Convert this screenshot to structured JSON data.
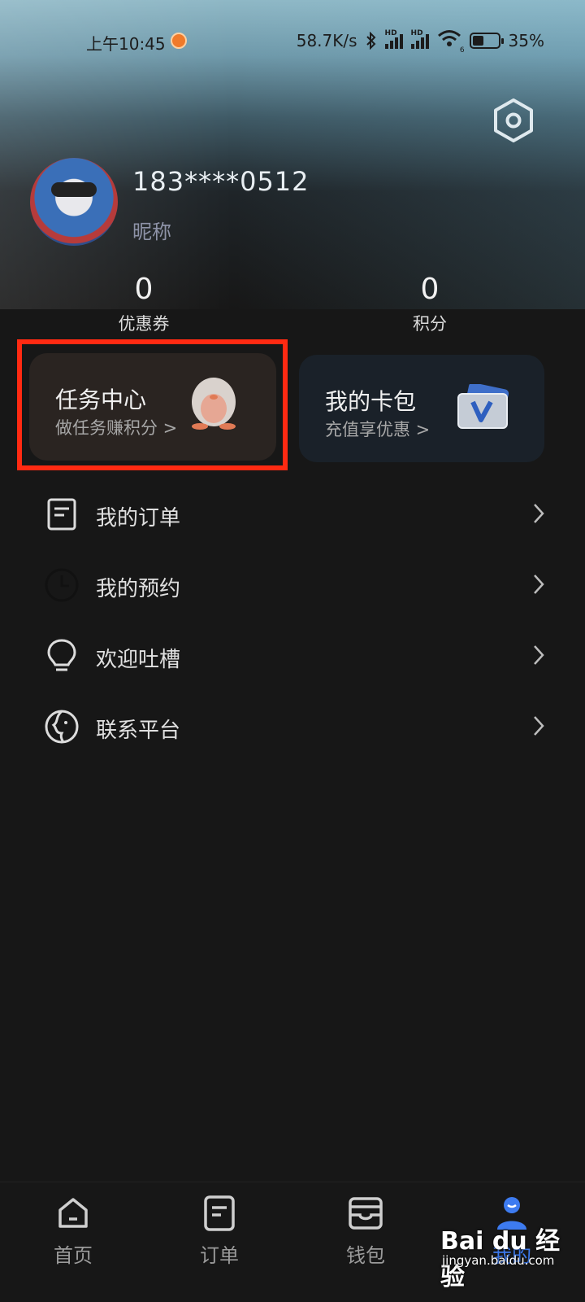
{
  "status_bar": {
    "time": "上午10:45",
    "net_speed": "58.7K/s",
    "battery": "35%",
    "hd1": "HD",
    "hd2": "HD",
    "wifi_sub": "6"
  },
  "profile": {
    "phone": "183****0512",
    "nickname": "昵称"
  },
  "stats": [
    {
      "value": "0",
      "label": "优惠券"
    },
    {
      "value": "0",
      "label": "积分"
    }
  ],
  "cards": {
    "task": {
      "title": "任务中心",
      "subtitle": "做任务赚积分 >"
    },
    "wallet": {
      "title": "我的卡包",
      "subtitle": "充值享优惠 >"
    }
  },
  "menu": [
    {
      "label": "我的订单",
      "icon": "order-list-icon"
    },
    {
      "label": "我的预约",
      "icon": "clock-icon"
    },
    {
      "label": "欢迎吐槽",
      "icon": "lightbulb-icon"
    },
    {
      "label": "联系平台",
      "icon": "contact-face-icon"
    }
  ],
  "tabs": [
    {
      "label": "首页",
      "icon": "home-icon",
      "active": false
    },
    {
      "label": "订单",
      "icon": "order-icon",
      "active": false
    },
    {
      "label": "钱包",
      "icon": "wallet-icon",
      "active": false
    },
    {
      "label": "我的",
      "icon": "user-icon",
      "active": true
    }
  ],
  "watermark": {
    "brand": "Bai du 经验",
    "url": "jingyan.baidu.com"
  },
  "colors": {
    "accent": "#3d7bf0",
    "highlight_border": "#ff2a12"
  }
}
